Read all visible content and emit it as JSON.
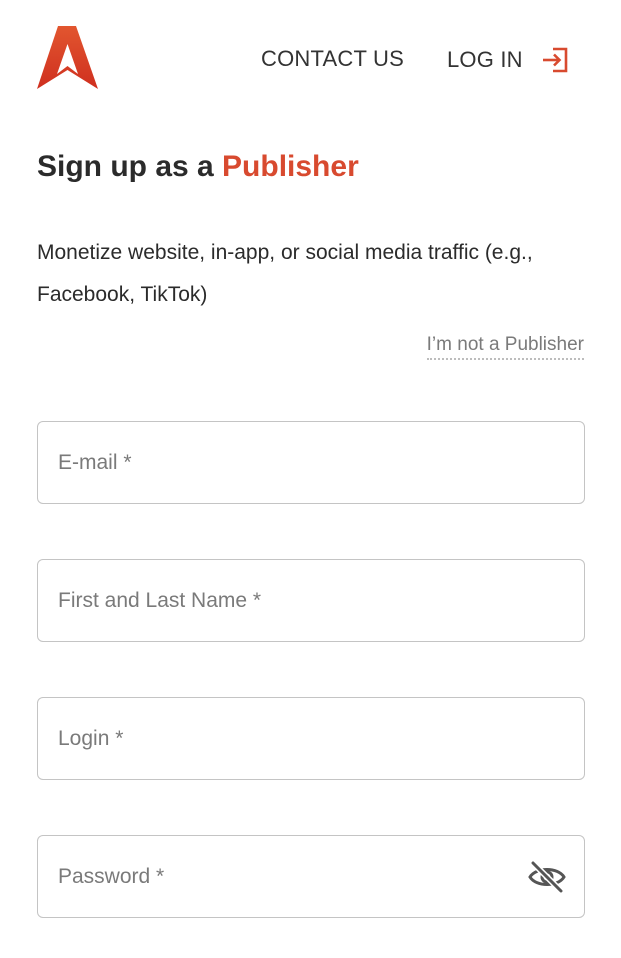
{
  "header": {
    "contact_label": "CONTACT US",
    "login_label": "LOG IN",
    "accent_color": "#d84a2f"
  },
  "title": {
    "prefix": "Sign up as a ",
    "highlight": "Publisher"
  },
  "subtitle": "Monetize website, in-app, or social media traffic (e.g., Facebook, TikTok)",
  "switch_role_link": "I’m not a Publisher",
  "form": {
    "email_placeholder": "E-mail *",
    "name_placeholder": "First and Last Name *",
    "login_placeholder": "Login *",
    "password_placeholder": "Password *",
    "password_toggle_icon": "eye-off-icon"
  }
}
